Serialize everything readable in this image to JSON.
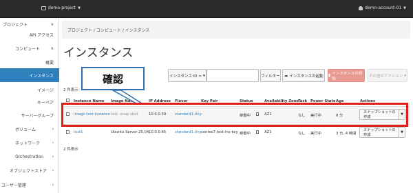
{
  "topbar": {
    "project": "demo-project",
    "account": "demo-account-01"
  },
  "sidebar": {
    "items": [
      {
        "label": "プロジェクト",
        "chevron": "∨"
      },
      {
        "label": "API アクセス"
      },
      {
        "label": "コンピュート",
        "chevron": "∨"
      },
      {
        "label": "概要"
      },
      {
        "label": "インスタンス"
      },
      {
        "label": "イメージ"
      },
      {
        "label": "キーペア"
      },
      {
        "label": "サーバーグループ"
      },
      {
        "label": "ボリューム",
        "chevron": "›"
      },
      {
        "label": "ネットワーク",
        "chevron": "›"
      },
      {
        "label": "Orchestration",
        "chevron": "›"
      },
      {
        "label": "オブジェクトストア",
        "chevron": "›"
      },
      {
        "label": "ユーザー管理",
        "chevron": "›"
      }
    ]
  },
  "breadcrumb": "プロジェクト / コンピュート / インスタンス",
  "page_title": "インスタンス",
  "toolbar": {
    "filter_select": "インスタンス ID =",
    "filter_button": "フィルター",
    "launch_button": "インスタンスの起動",
    "delete_button": "インスタンスの削除",
    "more_button": "その他のアクション"
  },
  "count_top": "2 件表示",
  "count_bottom": "2 件表示",
  "table": {
    "headers": [
      "Instance Name",
      "Image Name",
      "IP Address",
      "Flavor",
      "Key Pair",
      "Status",
      "Availability Zone",
      "Task",
      "Power State",
      "Age",
      "Actions"
    ],
    "rows": [
      {
        "instance_name": "image-test-instance",
        "image_name": "test -snap shot",
        "ip": "10.0.0.59",
        "flavor": "standard1.tiny",
        "key_pair": "-",
        "status": "稼働中",
        "az": "AZ1",
        "task": "なし",
        "power": "実行中",
        "age": "0 分",
        "action": "スナップショットの作成"
      },
      {
        "instance_name": "test1",
        "image_name": "Ubuntu Server 20.04",
        "ip": "10.0.0.65",
        "flavor": "standard1.tiny",
        "key_pair": "centos7-test-ins-key",
        "status": "稼働中",
        "az": "AZ1",
        "task": "なし",
        "power": "実行中",
        "age": "3 日, 4 時間",
        "action": "スナップショットの作成"
      }
    ]
  },
  "annotation": {
    "label": "確認",
    "box_color": "#e21d1d",
    "callout_color": "#2f6fb3"
  }
}
